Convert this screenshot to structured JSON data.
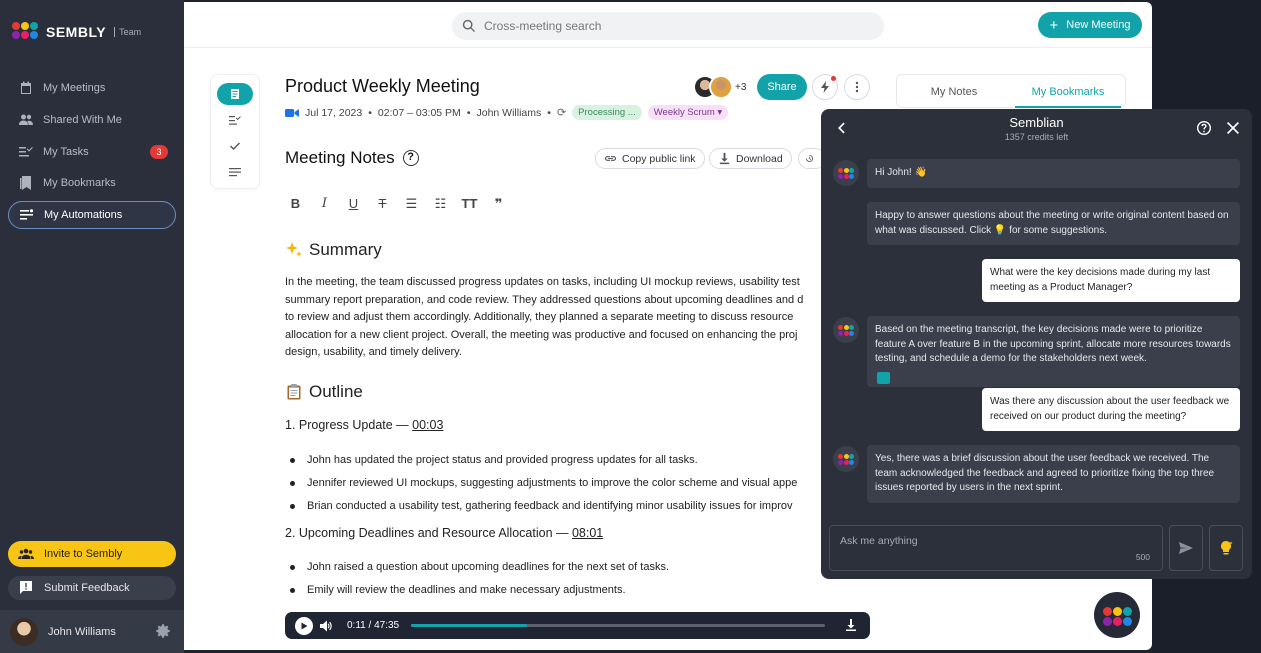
{
  "brand": {
    "name": "SEMBLY",
    "plan": "Team"
  },
  "sidebar": {
    "items": [
      {
        "label": "My Meetings",
        "icon": "calendar-icon"
      },
      {
        "label": "Shared With Me",
        "icon": "people-icon"
      },
      {
        "label": "My Tasks",
        "icon": "tasks-icon",
        "badge": "3"
      },
      {
        "label": "My Bookmarks",
        "icon": "bookmarks-icon"
      },
      {
        "label": "My Automations",
        "icon": "automations-icon"
      }
    ],
    "invite_label": "Invite to Sembly",
    "feedback_label": "Submit Feedback",
    "user_name": "John Williams"
  },
  "topbar": {
    "search_placeholder": "Cross-meeting search",
    "new_meeting_label": "New Meeting"
  },
  "meeting": {
    "title": "Product Weekly Meeting",
    "date": "Jul 17, 2023",
    "time": "02:07 – 03:05 PM",
    "owner": "John Williams",
    "status": "Processing ...",
    "tag": "Weekly Scrum",
    "participants_extra": "+3",
    "share_label": "Share"
  },
  "tabs": [
    "My Notes",
    "My Bookmarks"
  ],
  "notes": {
    "heading": "Meeting Notes",
    "copy_link_label": "Copy public link",
    "download_label": "Download",
    "summary_heading": "Summary",
    "summary_lines": [
      "In the meeting, the team discussed progress updates on tasks, including UI mockup reviews, usability test",
      "summary report preparation, and code review. They addressed questions about upcoming deadlines and d",
      "to review and adjust them accordingly. Additionally, they planned a separate meeting to discuss resource",
      "allocation for a new client project. Overall, the meeting was productive and focused on enhancing the proj",
      "design, usability, and timely delivery."
    ],
    "outline_heading": "Outline",
    "sections": [
      {
        "title": "1. Progress Update — ",
        "time": "00:03",
        "bullets": [
          "John has updated the project status and provided progress updates for all tasks.",
          "Jennifer reviewed UI mockups, suggesting adjustments to improve the color scheme and visual appe",
          "Brian conducted a usability test, gathering feedback and identifying minor usability issues for improv"
        ]
      },
      {
        "title": "2. Upcoming Deadlines and Resource Allocation — ",
        "time": "08:01",
        "bullets": [
          "John raised a question about upcoming deadlines for the next set of tasks.",
          "Emily will review the deadlines and make necessary adjustments."
        ]
      }
    ]
  },
  "player": {
    "current": "0:11",
    "total": "47:35",
    "progress": 0.28
  },
  "chat": {
    "title": "Semblian",
    "credits": "1357 credits left",
    "messages": [
      {
        "role": "bot",
        "text": "Hi John! 👋"
      },
      {
        "role": "bot",
        "text": "Happy to answer questions about the meeting or write original content based on what was discussed. Click 💡 for some suggestions."
      },
      {
        "role": "user",
        "text": "What were the key decisions made during my last meeting as a Product Manager?"
      },
      {
        "role": "bot",
        "text": "Based on the meeting transcript, the key decisions made were to prioritize feature A over feature B in the upcoming sprint, allocate more resources towards testing, and schedule a demo for the stakeholders next week."
      },
      {
        "role": "user",
        "text": "Was there any discussion about the user feedback we received on our product during the meeting?"
      },
      {
        "role": "bot",
        "text": "Yes, there was a brief discussion about the user feedback we received. The team acknowledged the feedback and agreed to prioritize fixing the top three issues reported by users in the next sprint."
      }
    ],
    "input_placeholder": "Ask me anything",
    "char_limit": "500"
  },
  "colors": {
    "accent": "#11a3a9",
    "yellow": "#f9c515",
    "sidebar": "#2b2f3b",
    "chat": "#2c303b"
  }
}
